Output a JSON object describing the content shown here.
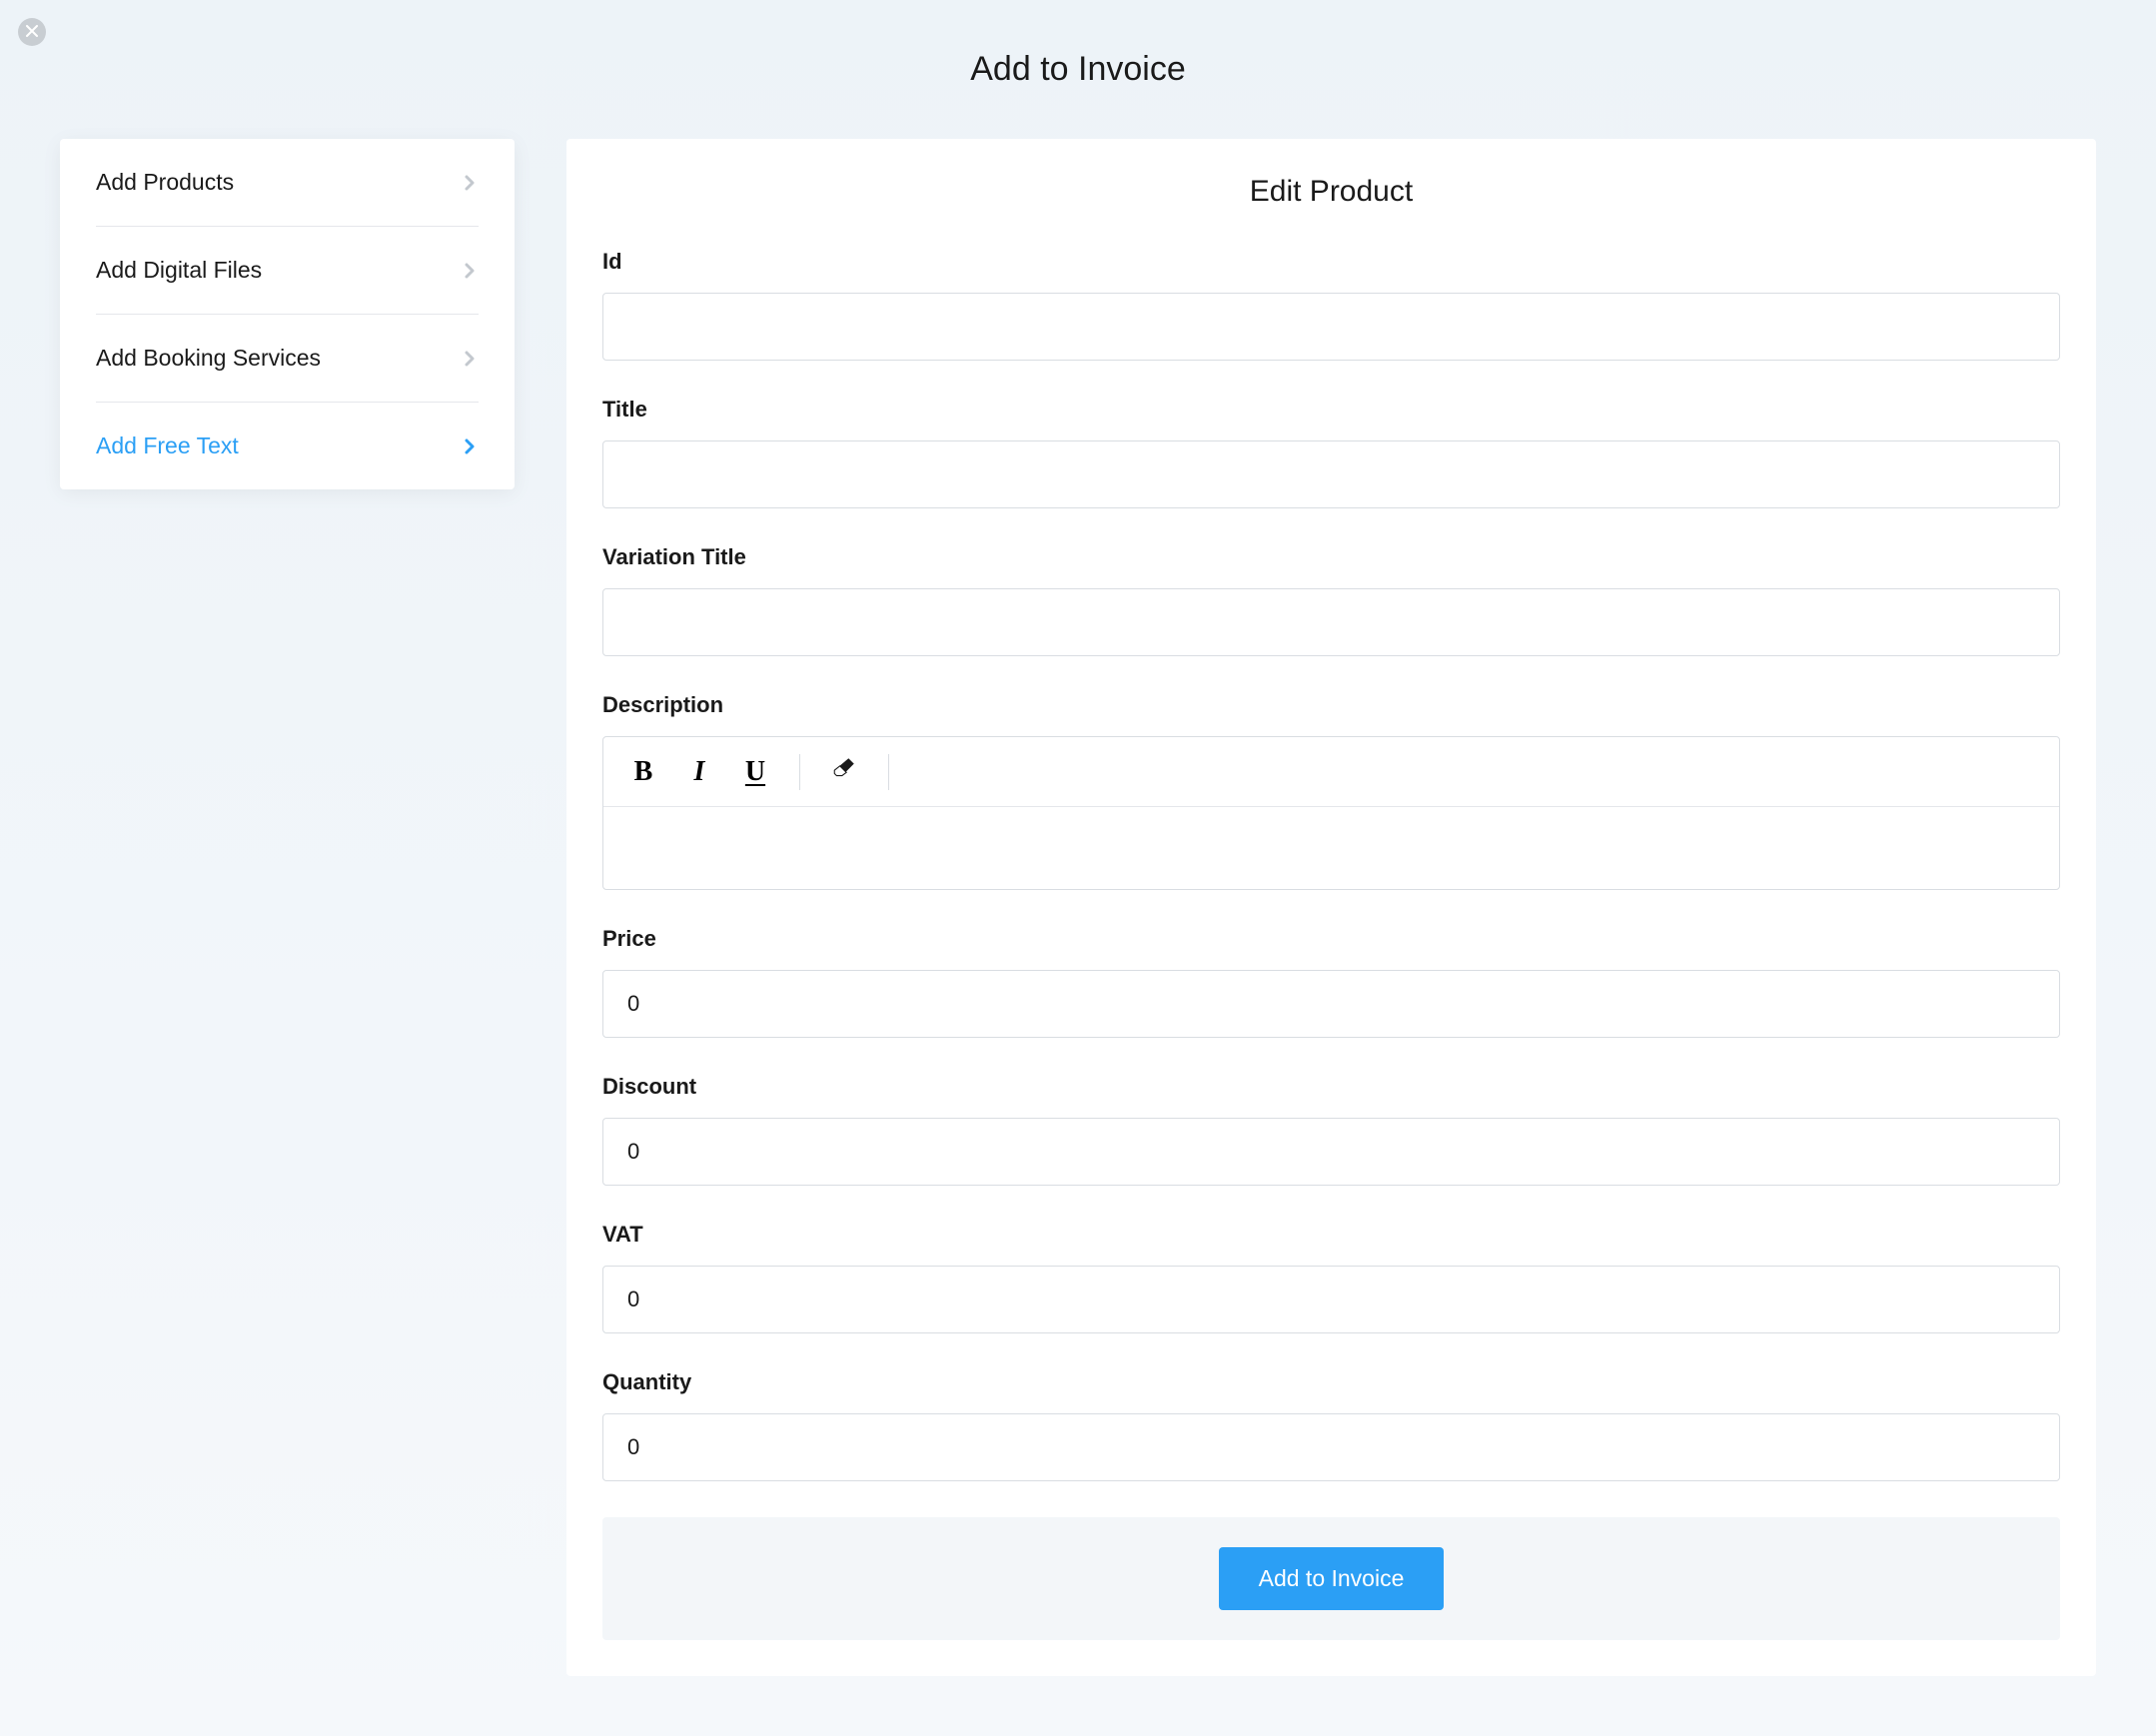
{
  "modal": {
    "title": "Add to Invoice"
  },
  "sidebar": {
    "items": [
      {
        "label": "Add Products",
        "active": false
      },
      {
        "label": "Add Digital Files",
        "active": false
      },
      {
        "label": "Add Booking Services",
        "active": false
      },
      {
        "label": "Add Free Text",
        "active": true
      }
    ]
  },
  "panel": {
    "title": "Edit Product",
    "fields": {
      "id": {
        "label": "Id",
        "value": ""
      },
      "title": {
        "label": "Title",
        "value": ""
      },
      "variation_title": {
        "label": "Variation Title",
        "value": ""
      },
      "description": {
        "label": "Description",
        "value": ""
      },
      "price": {
        "label": "Price",
        "value": "0"
      },
      "discount": {
        "label": "Discount",
        "value": "0"
      },
      "vat": {
        "label": "VAT",
        "value": "0"
      },
      "quantity": {
        "label": "Quantity",
        "value": "0"
      }
    },
    "submit_label": "Add to Invoice"
  },
  "icons": {
    "bold": "B",
    "italic": "I",
    "underline": "U"
  }
}
